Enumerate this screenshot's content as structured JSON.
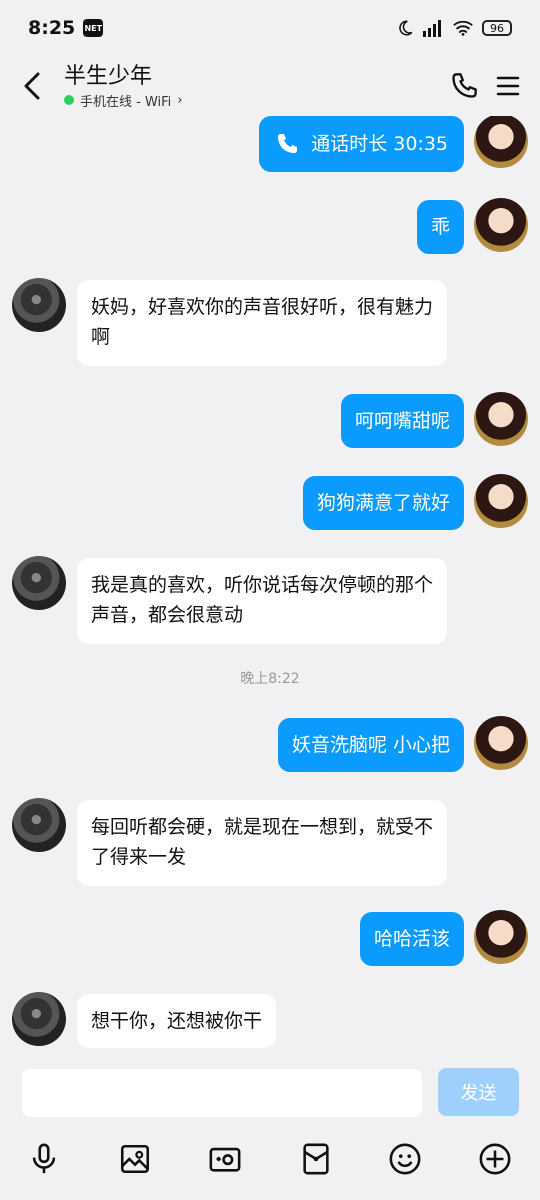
{
  "status_bar": {
    "time": "8:25",
    "battery": "96",
    "net_badge": "NET"
  },
  "header": {
    "contact_name": "半生少年",
    "online_status": "手机在线 - WiFi",
    "chevron": "›"
  },
  "messages": [
    {
      "from": "me",
      "type": "call",
      "text": "通话时长 30:35"
    },
    {
      "from": "me",
      "type": "text",
      "text": "乖"
    },
    {
      "from": "them",
      "type": "text",
      "text": "妖妈，好喜欢你的声音很好听，很有魅力啊"
    },
    {
      "from": "me",
      "type": "text",
      "text": "呵呵嘴甜呢"
    },
    {
      "from": "me",
      "type": "text",
      "text": "狗狗满意了就好"
    },
    {
      "from": "them",
      "type": "text",
      "text": "我是真的喜欢，听你说话每次停顿的那个声音，都会很意动"
    },
    {
      "type": "timestamp",
      "text": "晚上8:22"
    },
    {
      "from": "me",
      "type": "text",
      "text": "妖音洗脑呢 小心把"
    },
    {
      "from": "them",
      "type": "text",
      "text": "每回听都会硬，就是现在一想到，就受不了得来一发"
    },
    {
      "from": "me",
      "type": "text",
      "text": "哈哈活该"
    },
    {
      "from": "them",
      "type": "text",
      "text": "想干你，还想被你干"
    }
  ],
  "composer": {
    "send_label": "发送",
    "tools": [
      "microphone-icon",
      "image-icon",
      "camera-icon",
      "red-packet-icon",
      "emoji-icon",
      "plus-icon"
    ]
  },
  "colors": {
    "accent": "#0b9afe",
    "background": "#f1f1f4",
    "online": "#2fce5e"
  }
}
